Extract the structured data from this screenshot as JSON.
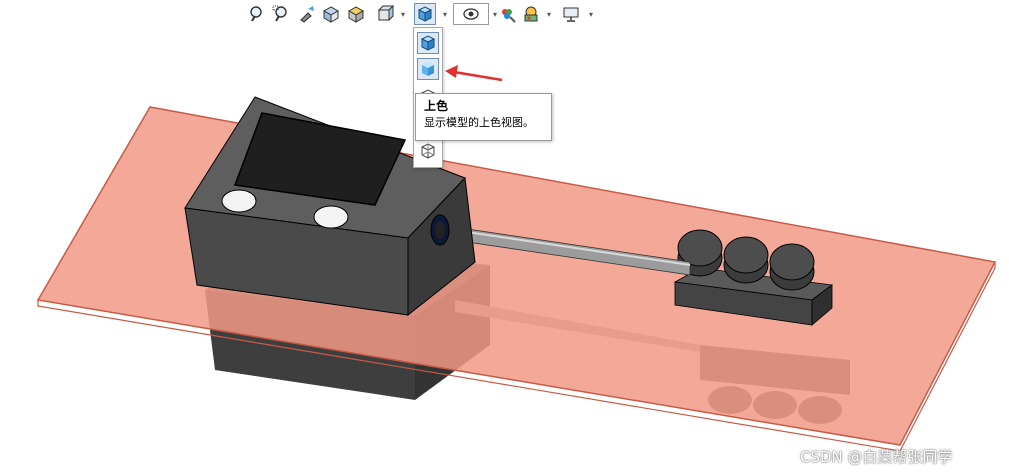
{
  "toolbar": {
    "icons": [
      "zoom-to-fit-icon",
      "zoom-to-area-icon",
      "previous-view-icon",
      "section-view-icon",
      "view-orientation-icon",
      "display-style-icon",
      "hide-show-items-icon",
      "edit-appearance-icon",
      "apply-scene-icon",
      "view-settings-icon"
    ],
    "active_tool": "display-style-icon"
  },
  "flyout": {
    "items": [
      "shaded-with-edges-icon",
      "shaded-icon",
      "hidden-lines-removed-icon",
      "hidden-lines-visible-icon",
      "wireframe-icon"
    ],
    "highlighted": "shaded-icon"
  },
  "tooltip": {
    "title": "上色",
    "description": "显示模型的上色视图。"
  },
  "colors": {
    "plate_fill": "#f29a86",
    "plate_edge": "#c85a46",
    "part_dark": "#4f4f4f",
    "screen": "#222222",
    "arrow": "#e03030",
    "accent_blue": "#4aa3df"
  },
  "watermark": "CSDN @白菜帮张同学"
}
